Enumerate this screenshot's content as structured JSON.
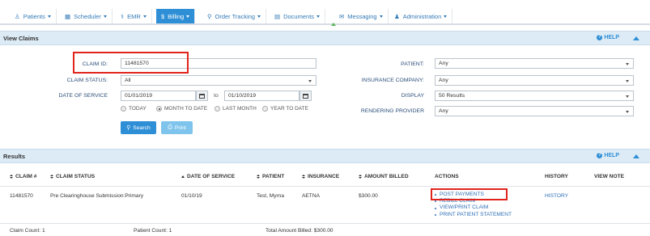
{
  "nav": {
    "items": [
      {
        "label": "Patients",
        "icon": "users-icon",
        "has_menu": true
      },
      {
        "label": "Scheduler",
        "icon": "calendar-icon",
        "has_menu": true
      },
      {
        "label": "EMR",
        "icon": "stethoscope-icon",
        "has_menu": true
      },
      {
        "label": "Billing",
        "icon": "dollar-icon",
        "has_menu": true,
        "active": true
      },
      {
        "label": "Order Tracking",
        "icon": "search-icon",
        "has_menu": true
      },
      {
        "label": "Documents",
        "icon": "document-icon",
        "has_menu": true
      },
      {
        "label": "Messaging",
        "icon": "envelope-icon",
        "has_menu": true
      },
      {
        "label": "Administration",
        "icon": "user-icon",
        "has_menu": true
      }
    ],
    "active_color": "#2f8fd6"
  },
  "view_claims": {
    "title": "View Claims",
    "help_label": "HELP",
    "form": {
      "claim_id_label": "CLAIM ID:",
      "claim_id_value": "11481570",
      "claim_status_label": "CLAIM STATUS:",
      "claim_status_value": "All",
      "date_of_service_label": "DATE OF SERVICE",
      "date_from": "01/01/2019",
      "to_label": "to",
      "date_to": "01/10/2019",
      "radios": [
        {
          "label": "TODAY",
          "selected": false
        },
        {
          "label": "MONTH TO DATE",
          "selected": true
        },
        {
          "label": "LAST MONTH",
          "selected": false
        },
        {
          "label": "YEAR TO DATE",
          "selected": false
        }
      ],
      "search_label": "Search",
      "print_label": "Print",
      "patient_label": "PATIENT:",
      "patient_value": "Any",
      "insurance_label": "INSURANCE COMPANY:",
      "insurance_value": "Any",
      "display_label": "DISPLAY",
      "display_value": "50 Results",
      "rendering_label": "RENDERING PROVIDER",
      "rendering_value": "Any"
    }
  },
  "results": {
    "title": "Results",
    "help_label": "HELP",
    "columns": [
      "CLAIM #",
      "CLAIM STATUS",
      "DATE OF SERVICE",
      "PATIENT",
      "INSURANCE",
      "AMOUNT BILLED",
      "ACTIONS",
      "HISTORY",
      "VIEW NOTE"
    ],
    "row": {
      "claim_number": "11481570",
      "claim_status": "Pre Clearinghouse Submission:Primary",
      "date_of_service": "01/10/19",
      "patient": "Test, Myrna",
      "insurance": "AETNA",
      "amount_billed": "$300.00",
      "actions": [
        "POST PAYMENTS",
        "REBILL CLAIM",
        "VIEW/PRINT CLAIM",
        "PRINT PATIENT STATEMENT"
      ],
      "history": "HISTORY"
    },
    "footer": {
      "claim_count": "Claim Count: 1",
      "patient_count": "Patient Count: 1",
      "total_amount": "Total Amount Billed: $300.00"
    }
  },
  "colors": {
    "accent": "#2f8fd6",
    "highlight_box": "#e0241d",
    "section_bar": "#dcebf5"
  }
}
